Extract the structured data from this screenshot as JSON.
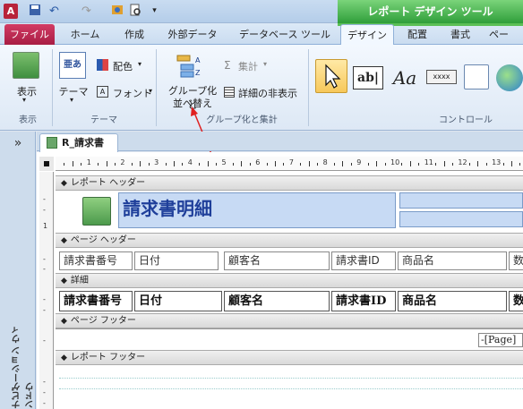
{
  "title_bar": {
    "app_icon": "A",
    "contextual_title": "レポート デザイン ツール"
  },
  "tabs": [
    "ファイル",
    "ホーム",
    "作成",
    "外部データ",
    "データベース ツール",
    "デザイン",
    "配置",
    "書式",
    "ペー"
  ],
  "ribbon": {
    "view": {
      "label": "表示",
      "group": "表示"
    },
    "theme": {
      "label": "テーマ",
      "colors": "配色",
      "fonts": "フォント",
      "group": "テーマ"
    },
    "grouping": {
      "group_sort_line1": "グループ化と",
      "group_sort_line2": "並べ替え",
      "totals": "集計",
      "hide_details": "詳細の非表示",
      "group": "グループ化と集計"
    },
    "controls": {
      "group": "コントロール",
      "label_text": "Aa",
      "textbox_text": "ab|",
      "button_text": "xxxx"
    }
  },
  "nav": {
    "toggle": "»",
    "label": "ナビゲーション ウィンドウ"
  },
  "document": {
    "tab": "R_請求書",
    "ruler_numbers": [
      "1",
      "2",
      "3",
      "4",
      "5",
      "6",
      "7",
      "8",
      "9",
      "10",
      "11",
      "12",
      "13",
      "14"
    ],
    "vruler": [
      "-",
      "-",
      "1",
      "-",
      "-",
      "-",
      "-",
      "-",
      "-",
      "-",
      "-"
    ],
    "sections": {
      "report_header": "レポート ヘッダー",
      "page_header": "ページ ヘッダー",
      "detail": "詳細",
      "page_footer": "ページ フッター",
      "report_footer": "レポート フッター"
    },
    "report_title": "請求書明細",
    "header_labels": [
      "請求書番号",
      "日付",
      "顧客名",
      "請求書ID",
      "商品名",
      "数"
    ],
    "detail_fields": [
      "請求書番号",
      "日付",
      "顧客名",
      "請求書ID",
      "商品名",
      "数"
    ],
    "page_footer_field": "-[Page]"
  }
}
